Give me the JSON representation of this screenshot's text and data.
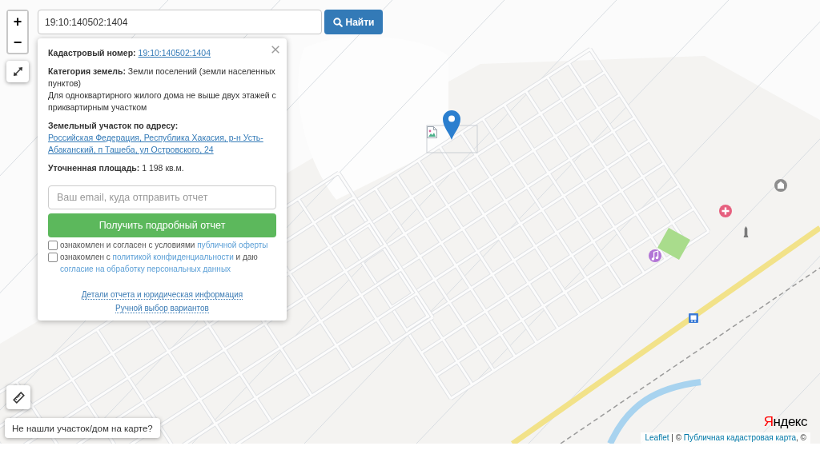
{
  "zoom": {
    "in": "+",
    "out": "−"
  },
  "search": {
    "value": "19:10:140502:1404",
    "button": "Найти"
  },
  "popup": {
    "cadastral_number": {
      "label": "Кадастровый номер:",
      "value": "19:10:140502:1404"
    },
    "land_category": "**Категория земель:** Земли поселений (земли населенных пунктов)",
    "permitted_use": "Для одноквартирного жилого дома не выше двух этажей с приквартирным участком",
    "address": {
      "label": "Земельный участок по адресу:",
      "value": "Российская Федерация, Республика Хакасия, р-н Усть-Абаканский, п Ташеба, ул Островского, 24"
    },
    "area": "**Уточненная площадь:** 1 198 кв.м.",
    "email_field": {
      "placeholder": "Ваш email, куда отправить отчет"
    },
    "report_button": "Получить подробный отчет",
    "agreements": [
      {
        "checked": false,
        "parts": [
          {
            "kind": "text",
            "text": "ознакомлен и согласен с условиями "
          },
          {
            "kind": "link",
            "text": "публичной оферты"
          }
        ]
      },
      {
        "checked": false,
        "parts": [
          {
            "kind": "text",
            "text": "ознакомлен с "
          },
          {
            "kind": "link",
            "text": "политикой конфиденциальности"
          },
          {
            "kind": "text",
            "text": " и даю "
          },
          {
            "kind": "link",
            "text": "согласие на обработку персональных данных"
          }
        ]
      }
    ],
    "links": [
      "Детали отчета и юридическая информация",
      "Ручной выбор вариантов"
    ]
  },
  "not_found_button": "Не нашли участок/дом на карте?",
  "map_logo": "Яндекс",
  "attribution": [
    {
      "kind": "link",
      "text": "Leaflet"
    },
    {
      "kind": "text",
      "text": " | © "
    },
    {
      "kind": "link",
      "text": "Публичная кадастровая карта"
    },
    {
      "kind": "text",
      "text": ", ©"
    }
  ]
}
